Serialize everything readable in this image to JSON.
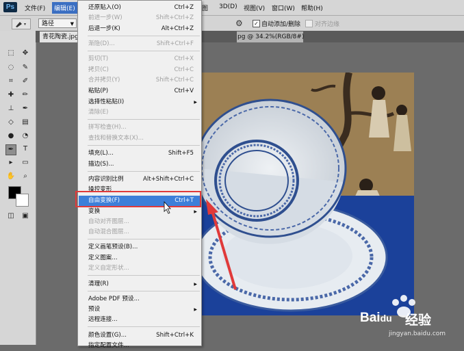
{
  "app": {
    "logo": "Ps"
  },
  "menubar": {
    "items": [
      "文件(F)",
      "编辑(E)",
      "3D(D)",
      "视图(V)",
      "窗口(W)",
      "帮助(H)"
    ],
    "active": "编辑(E)",
    "partial_item": "图"
  },
  "options_bar": {
    "tool_mode": "路径",
    "auto_add_delete": "自动添加/删除",
    "auto_add_checked": true,
    "align_edges": "对齐边缘",
    "align_checked": false
  },
  "document": {
    "tab_title": "青花陶瓷.jpg",
    "tab_suffix": "pg @ 34.2%(RGB/8#)"
  },
  "edit_menu": {
    "items": [
      {
        "label": "还原贴入(O)",
        "shortcut": "Ctrl+Z",
        "disabled": false
      },
      {
        "label": "前进一步(W)",
        "shortcut": "Shift+Ctrl+Z",
        "disabled": true
      },
      {
        "label": "后退一步(K)",
        "shortcut": "Alt+Ctrl+Z",
        "disabled": false
      },
      {
        "label": "渐隐(D)...",
        "shortcut": "Shift+Ctrl+F",
        "disabled": true
      },
      {
        "label": "剪切(T)",
        "shortcut": "Ctrl+X",
        "disabled": true
      },
      {
        "label": "拷贝(C)",
        "shortcut": "Ctrl+C",
        "disabled": true
      },
      {
        "label": "合并拷贝(Y)",
        "shortcut": "Shift+Ctrl+C",
        "disabled": true
      },
      {
        "label": "粘贴(P)",
        "shortcut": "Ctrl+V",
        "disabled": false
      },
      {
        "label": "选择性粘贴(I)",
        "shortcut": "",
        "disabled": false,
        "submenu": true
      },
      {
        "label": "清除(E)",
        "shortcut": "",
        "disabled": true
      },
      {
        "label": "拼写检查(H)...",
        "shortcut": "",
        "disabled": true
      },
      {
        "label": "查找和替换文本(X)...",
        "shortcut": "",
        "disabled": true
      },
      {
        "label": "填充(L)...",
        "shortcut": "Shift+F5",
        "disabled": false
      },
      {
        "label": "描边(S)...",
        "shortcut": "",
        "disabled": false
      },
      {
        "label": "内容识别比例",
        "shortcut": "Alt+Shift+Ctrl+C",
        "disabled": false
      },
      {
        "label": "操控变形",
        "shortcut": "",
        "disabled": false
      },
      {
        "label": "自由变换(F)",
        "shortcut": "Ctrl+T",
        "disabled": false,
        "highlighted": true
      },
      {
        "label": "变换",
        "shortcut": "",
        "disabled": false,
        "submenu": true
      },
      {
        "label": "自动对齐图层...",
        "shortcut": "",
        "disabled": true
      },
      {
        "label": "自动混合图层...",
        "shortcut": "",
        "disabled": true
      },
      {
        "label": "定义画笔预设(B)...",
        "shortcut": "",
        "disabled": false
      },
      {
        "label": "定义图案...",
        "shortcut": "",
        "disabled": false
      },
      {
        "label": "定义自定形状...",
        "shortcut": "",
        "disabled": true
      },
      {
        "label": "清理(R)",
        "shortcut": "",
        "disabled": false,
        "submenu": true
      },
      {
        "label": "Adobe PDF 预设...",
        "shortcut": "",
        "disabled": false
      },
      {
        "label": "预设",
        "shortcut": "",
        "disabled": false,
        "submenu": true
      },
      {
        "label": "远程连接...",
        "shortcut": "",
        "disabled": false
      },
      {
        "label": "颜色设置(G)...",
        "shortcut": "Shift+Ctrl+K",
        "disabled": false
      },
      {
        "label": "指定配置文件...",
        "shortcut": "",
        "disabled": false
      }
    ]
  },
  "watermark": {
    "brand": "Bai",
    "brand_suffix": "du",
    "text": "经验",
    "url": "jingyan.baidu.com"
  },
  "colors": {
    "menu_highlight": "#3d7fd9",
    "annotation": "#e03a3a",
    "tablecloth": "#2148a4"
  }
}
